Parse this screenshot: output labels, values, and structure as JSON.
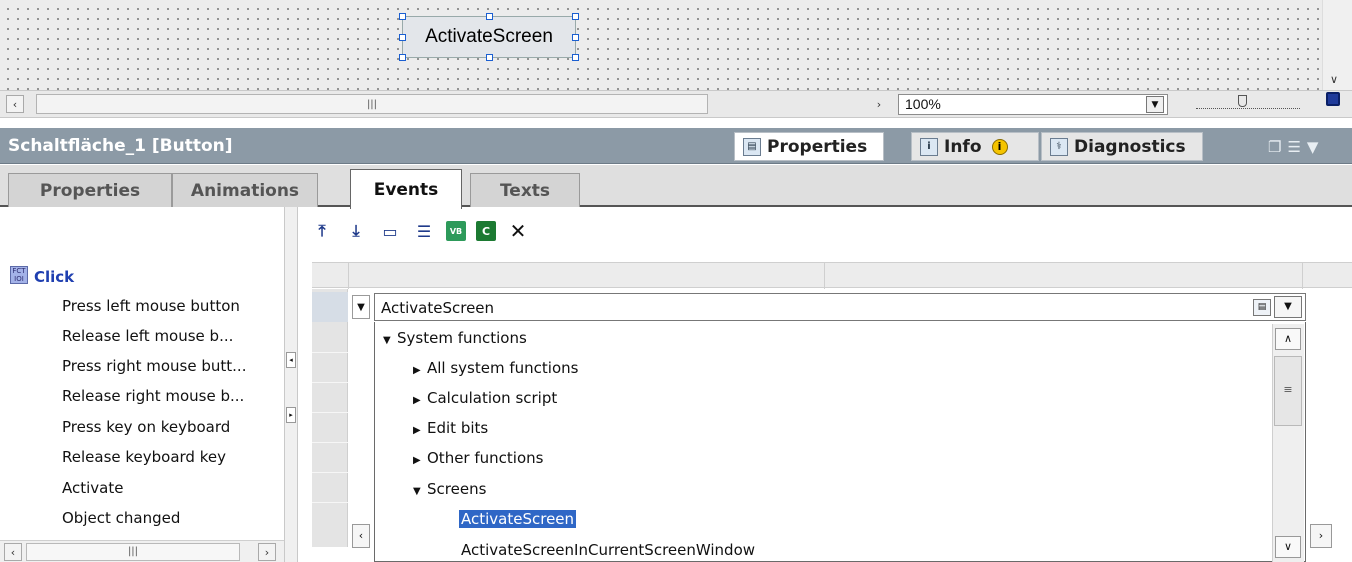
{
  "canvas": {
    "button_text": "ActivateScreen"
  },
  "canvas_bar": {
    "hscroll_grip": "|||",
    "zoom_value": "100%"
  },
  "inspector": {
    "title": "Schaltfläche_1 [Button]",
    "right_tabs": {
      "properties": "Properties",
      "info": "Info",
      "diagnostics": "Diagnostics"
    },
    "subtabs": {
      "properties": "Properties",
      "animations": "Animations",
      "events": "Events",
      "texts": "Texts"
    }
  },
  "events": {
    "selected": "Click",
    "items": [
      "Press left mouse button",
      "Release left mouse b...",
      "Press right mouse butt...",
      "Release right mouse b...",
      "Press key on keyboard",
      "Release keyboard key",
      "Activate",
      "Object changed"
    ],
    "hscroll_grip": "|||"
  },
  "function_list": {
    "current_value": "ActivateScreen",
    "tree": {
      "root": "System functions",
      "children": [
        "All system functions",
        "Calculation script",
        "Edit bits",
        "Other functions",
        "Screens"
      ],
      "screen_functions": [
        "ActivateScreen",
        "ActivateScreenInCurrentScreenWindow"
      ]
    },
    "scroll_grip": "≡"
  },
  "icons": {
    "arrow_left": "‹",
    "arrow_right": "›",
    "scroll_down": "∨",
    "scroll_up": "∧",
    "dropdown": "▼",
    "collapsed": "▶",
    "expanded": "▼",
    "delete": "✕"
  }
}
